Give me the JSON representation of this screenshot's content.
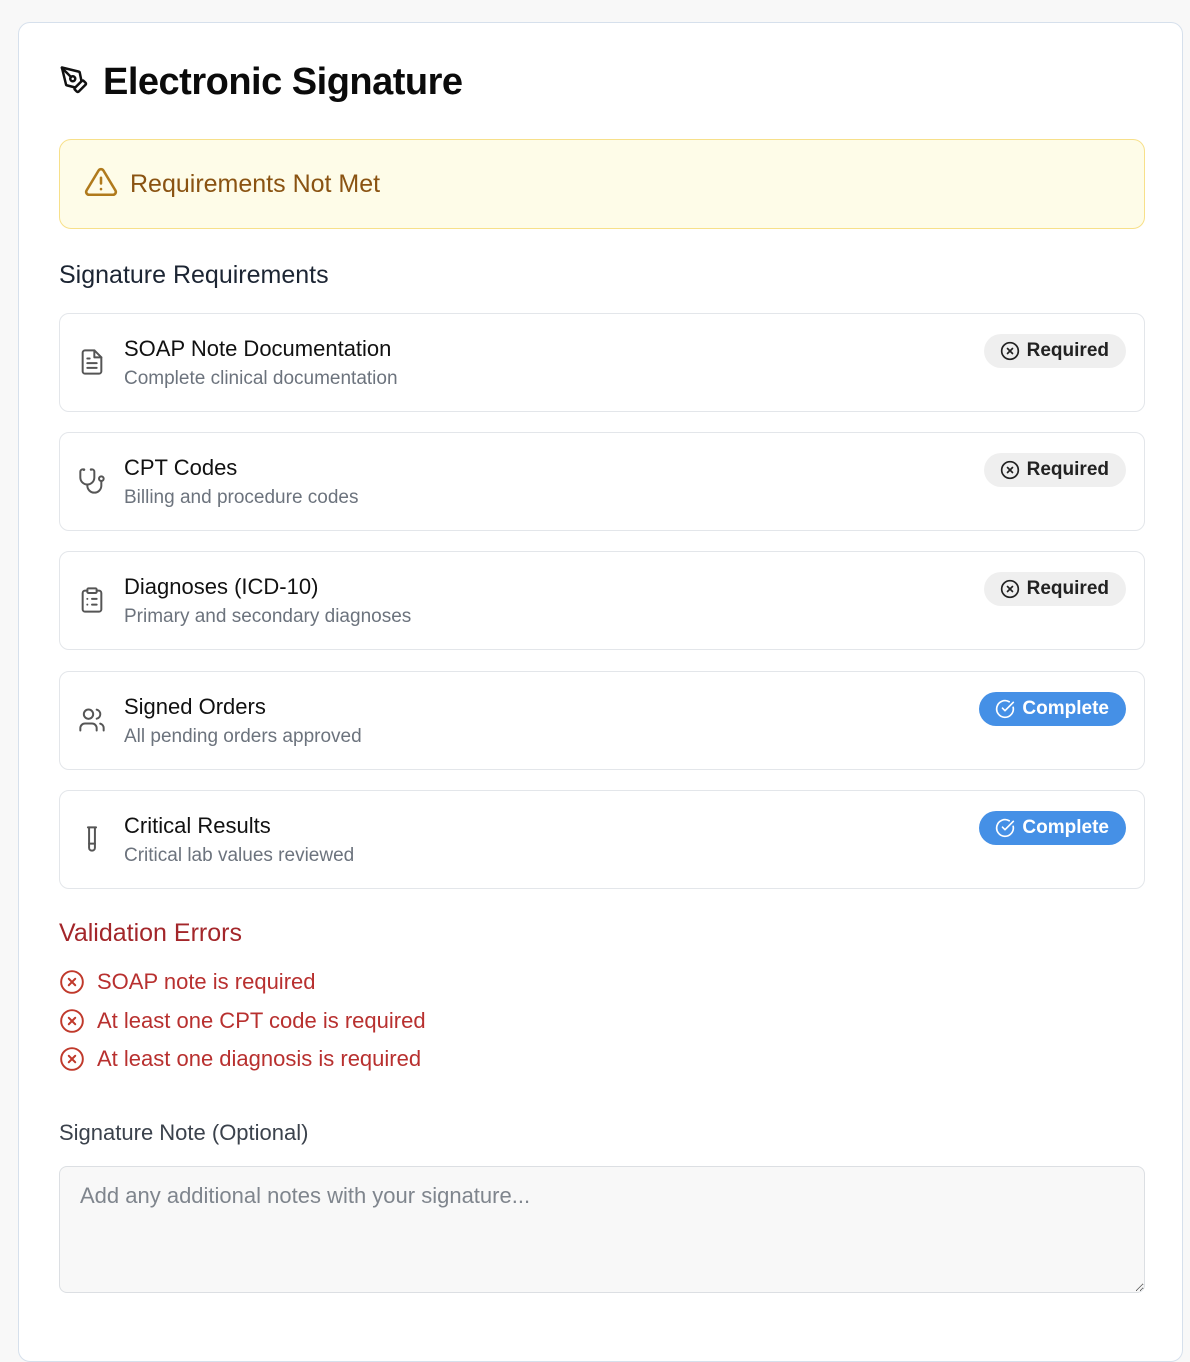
{
  "header": {
    "title": "Electronic Signature",
    "icon": "pen-tool-icon"
  },
  "alert": {
    "text": "Requirements Not Met",
    "icon": "warning-triangle-icon",
    "color": "#8a5312",
    "background": "#fefce8"
  },
  "requirements": {
    "heading": "Signature Requirements",
    "items": [
      {
        "name": "SOAP Note Documentation",
        "description": "Complete clinical documentation",
        "icon": "document-icon",
        "status": "Required"
      },
      {
        "name": "CPT Codes",
        "description": "Billing and procedure codes",
        "icon": "stethoscope-icon",
        "status": "Required"
      },
      {
        "name": "Diagnoses (ICD-10)",
        "description": "Primary and secondary diagnoses",
        "icon": "clipboard-list-icon",
        "status": "Required"
      },
      {
        "name": "Signed Orders",
        "description": "All pending orders approved",
        "icon": "users-icon",
        "status": "Complete"
      },
      {
        "name": "Critical Results",
        "description": "Critical lab values reviewed",
        "icon": "test-tube-icon",
        "status": "Complete"
      }
    ]
  },
  "validation": {
    "heading": "Validation Errors",
    "errors": [
      "SOAP note is required",
      "At least one CPT code is required",
      "At least one diagnosis is required"
    ]
  },
  "note": {
    "label": "Signature Note (Optional)",
    "placeholder": "Add any additional notes with your signature...",
    "value": ""
  },
  "colors": {
    "complete": "#4590e6",
    "error": "#b8302f",
    "required_badge": "#efefef"
  }
}
